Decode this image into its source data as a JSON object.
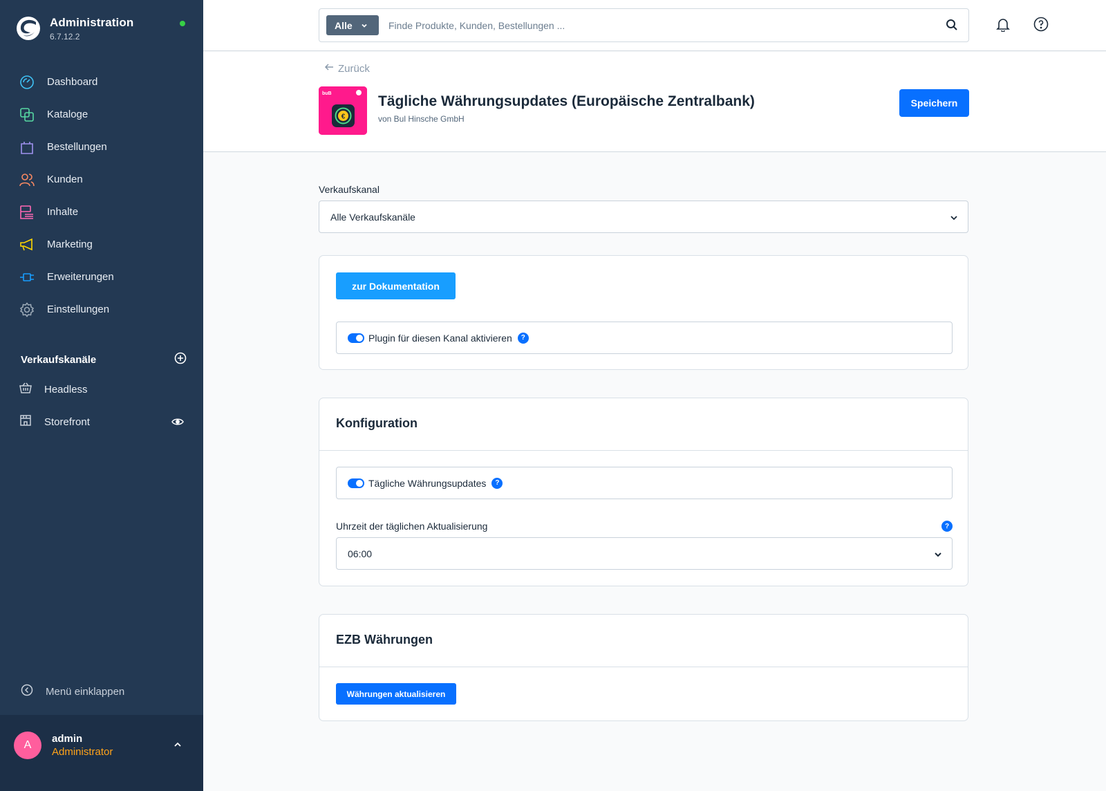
{
  "app": {
    "title": "Administration",
    "version": "6.7.12.2",
    "status_color": "#37d046"
  },
  "sidebar": {
    "items": [
      {
        "label": "Dashboard",
        "icon": "dashboard-icon",
        "color": "#3fc1f4"
      },
      {
        "label": "Kataloge",
        "icon": "catalog-icon",
        "color": "#57d9a3"
      },
      {
        "label": "Bestellungen",
        "icon": "shopping-bag-icon",
        "color": "#a092f0"
      },
      {
        "label": "Kunden",
        "icon": "users-icon",
        "color": "#f88962"
      },
      {
        "label": "Inhalte",
        "icon": "content-icon",
        "color": "#ff68b4"
      },
      {
        "label": "Marketing",
        "icon": "megaphone-icon",
        "color": "#ffd700"
      },
      {
        "label": "Erweiterungen",
        "icon": "plug-icon",
        "color": "#189eff"
      },
      {
        "label": "Einstellungen",
        "icon": "gear-icon",
        "color": "#9aa8b5"
      }
    ],
    "sales_channels_title": "Verkaufskanäle",
    "sales_channels": [
      {
        "label": "Headless",
        "icon": "basket-icon"
      },
      {
        "label": "Storefront",
        "icon": "storefront-icon"
      }
    ],
    "collapse_label": "Menü einklappen"
  },
  "user": {
    "initial": "A",
    "name": "admin",
    "role": "Administrator"
  },
  "search": {
    "type_label": "Alle",
    "placeholder": "Finde Produkte, Kunden, Bestellungen ..."
  },
  "header": {
    "back_label": "Zurück",
    "plugin_title": "Tägliche Währungsupdates (Europäische Zentralbank)",
    "plugin_vendor": "von Bul Hinsche GmbH",
    "save_label": "Speichern",
    "icon_text": "buB"
  },
  "sales_channel": {
    "label": "Verkaufskanal",
    "value": "Alle Verkaufskanäle"
  },
  "activation_card": {
    "doc_button": "zur Dokumentation",
    "toggle_label": "Plugin für diesen Kanal aktivieren",
    "toggle_on": true
  },
  "config_card": {
    "title": "Konfiguration",
    "toggle_label": "Tägliche Währungsupdates",
    "toggle_on": true,
    "time_label": "Uhrzeit der täglichen Aktualisierung",
    "time_value": "06:00"
  },
  "ecb_card": {
    "title": "EZB Währungen",
    "button_label": "Währungen aktualisieren"
  },
  "help_mark": "?"
}
